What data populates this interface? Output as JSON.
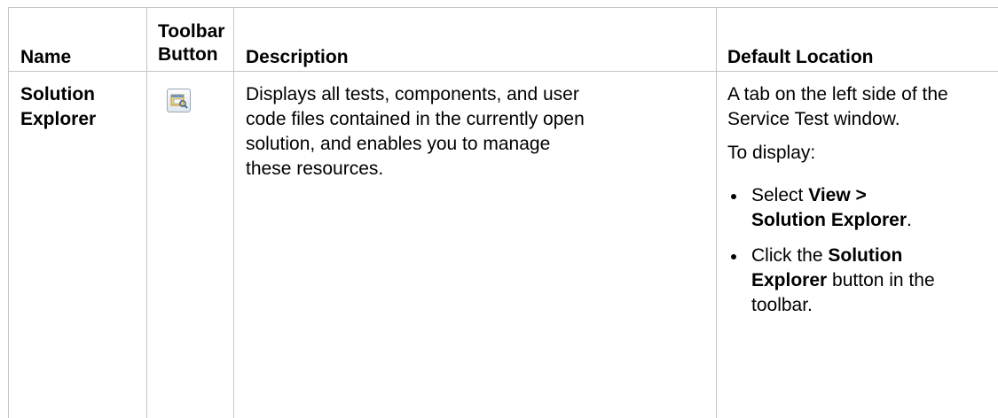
{
  "table": {
    "headers": {
      "name": "Name",
      "toolbar_button_line1": "Toolbar",
      "toolbar_button_line2": "Button",
      "description": "Description",
      "default_location": "Default Location"
    },
    "rows": [
      {
        "name_line1": "Solution",
        "name_line2": "Explorer",
        "toolbar_icon": "solution-explorer-icon",
        "description_lines": [
          "Displays all tests, components, and user",
          "code files contained in the currently open",
          "solution, and enables you to manage",
          "these resources."
        ],
        "location": {
          "line1": "A tab on the left side of the",
          "line2": "Service Test window.",
          "to_display": "To display:",
          "bullet1": {
            "prefix": "Select ",
            "bold1": "View >",
            "bold2": "Solution Explorer",
            "suffix": "."
          },
          "bullet2": {
            "prefix": "Click the ",
            "bold1": "Solution",
            "bold2": "Explorer",
            "suffix1": " button in the",
            "suffix2": "toolbar."
          }
        }
      }
    ]
  }
}
